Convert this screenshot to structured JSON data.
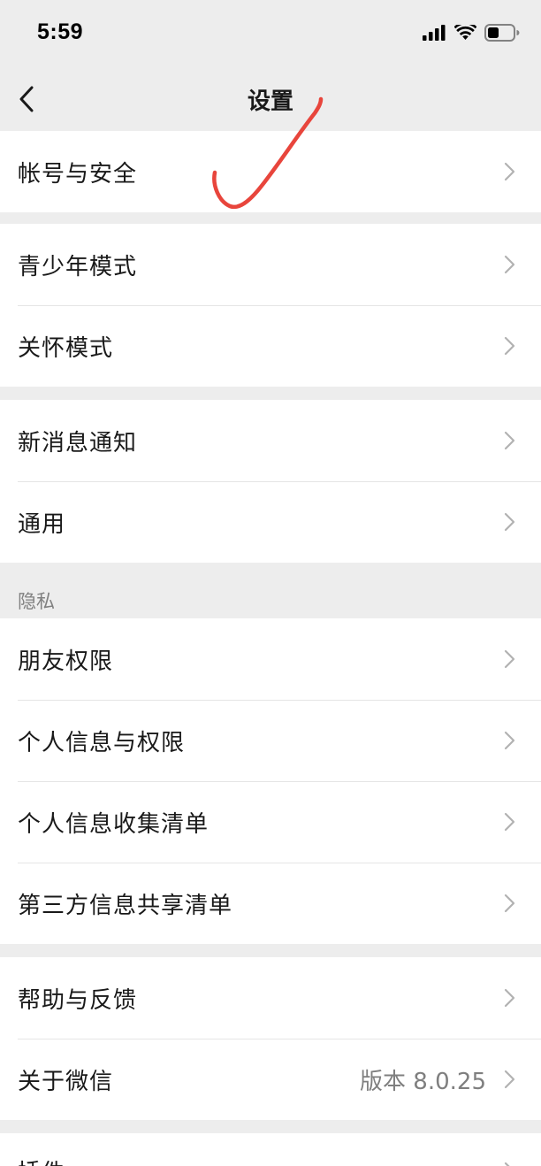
{
  "status_bar": {
    "time": "5:59"
  },
  "nav": {
    "title": "设置"
  },
  "groups": [
    {
      "items": [
        {
          "label": "帐号与安全"
        }
      ]
    },
    {
      "items": [
        {
          "label": "青少年模式"
        },
        {
          "label": "关怀模式"
        }
      ]
    },
    {
      "items": [
        {
          "label": "新消息通知"
        },
        {
          "label": "通用"
        }
      ]
    },
    {
      "section_title": "隐私",
      "items": [
        {
          "label": "朋友权限"
        },
        {
          "label": "个人信息与权限"
        },
        {
          "label": "个人信息收集清单"
        },
        {
          "label": "第三方信息共享清单"
        }
      ]
    },
    {
      "items": [
        {
          "label": "帮助与反馈"
        },
        {
          "label": "关于微信",
          "value": "版本 8.0.25"
        }
      ]
    },
    {
      "items": [
        {
          "label": "插件"
        }
      ]
    }
  ],
  "icons": [
    "chevron-left-icon",
    "chevron-right-icon",
    "signal-icon",
    "wifi-icon",
    "battery-icon"
  ],
  "annotation": {
    "color": "#e8453c"
  }
}
